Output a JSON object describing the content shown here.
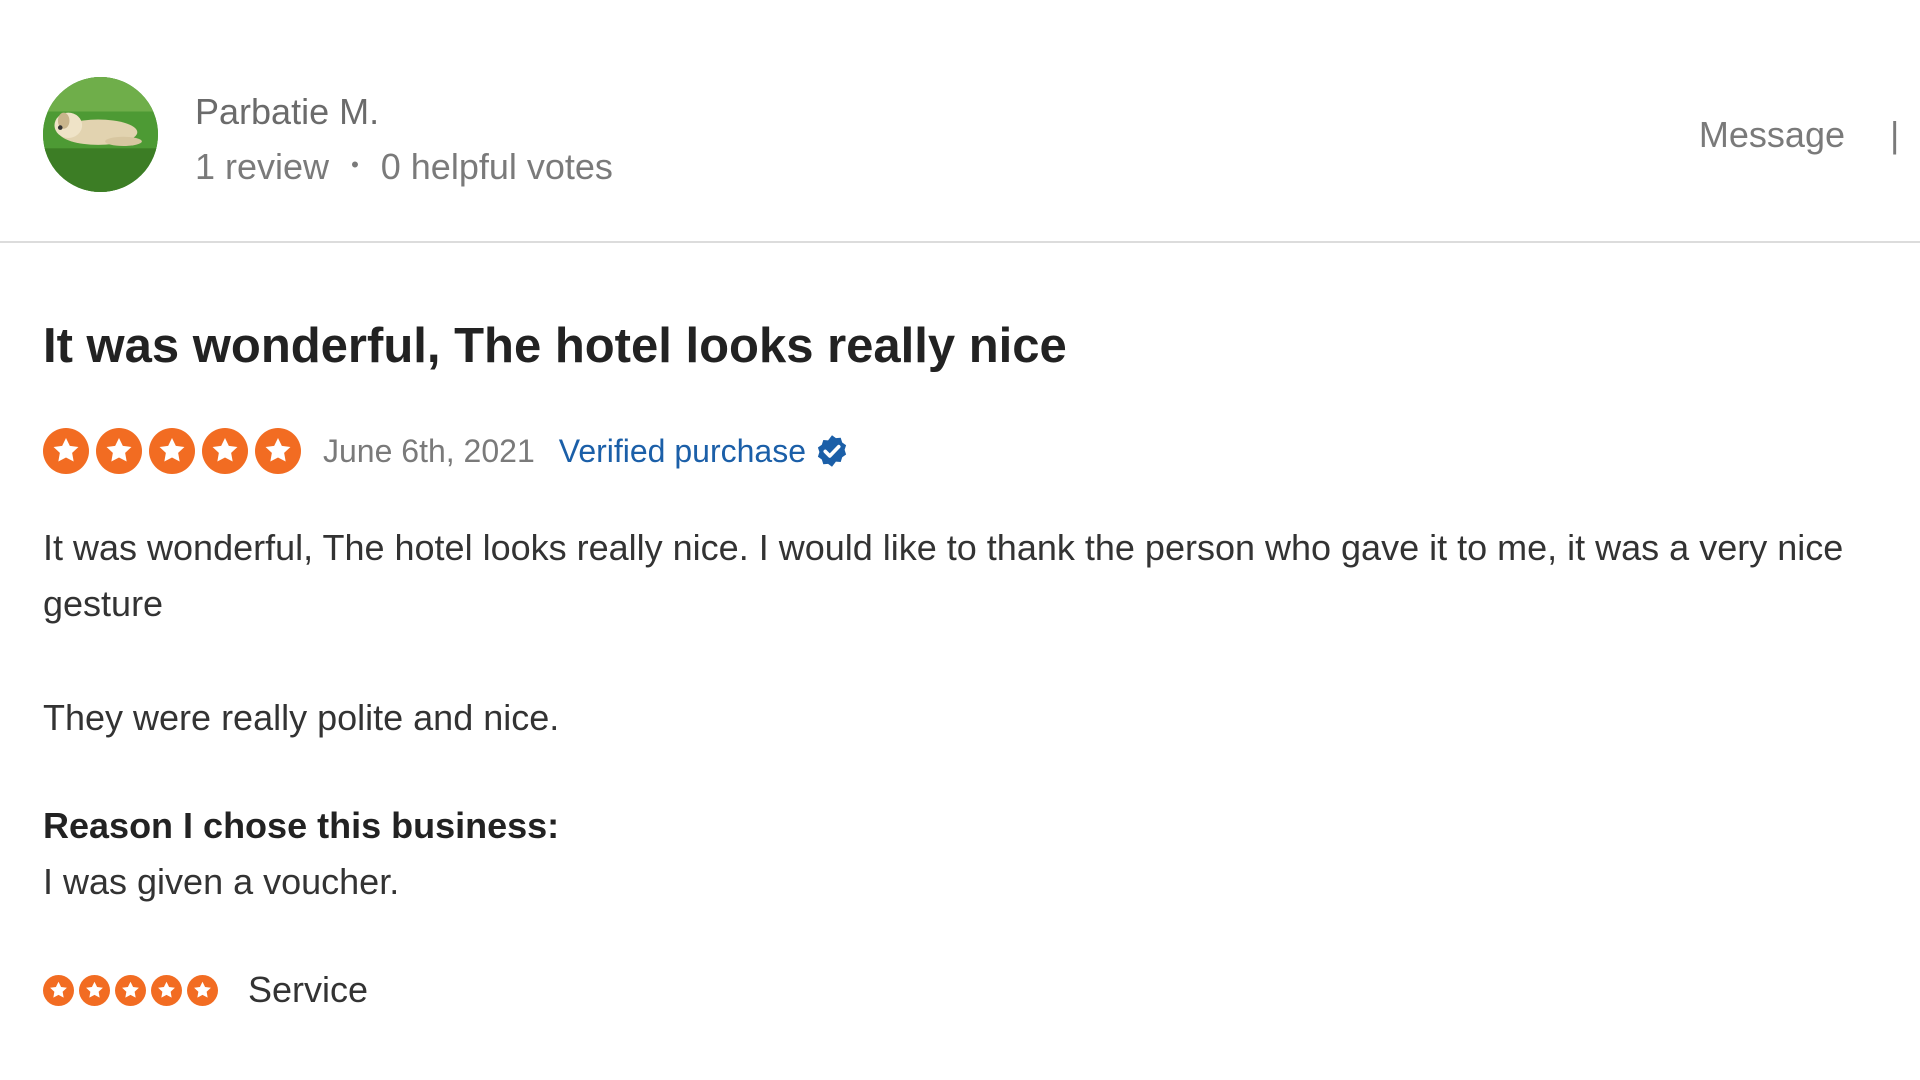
{
  "reviewer": {
    "name": "Parbatie M.",
    "reviews": "1 review",
    "separator": "•",
    "helpful_votes": "0 helpful votes",
    "message_label": "Message",
    "divider": "|"
  },
  "review": {
    "title": "It was wonderful, The hotel looks really nice",
    "rating": 5,
    "rating_max": 5,
    "date": "June 6th, 2021",
    "verified_label": "Verified purchase",
    "body_1": "It was wonderful, The hotel looks really nice. I would like to thank the person who gave it to me, it was a very nice gesture",
    "body_2": "They were really polite and nice.",
    "reason_label": "Reason I chose this business:",
    "reason_text": "I was given a voucher.",
    "sub_ratings": [
      {
        "label": "Service",
        "rating": 5
      }
    ]
  },
  "colors": {
    "star": "#f26c22",
    "verified": "#1b5fa8",
    "text": "#333333",
    "muted": "#7a7a7a"
  },
  "icons": {
    "star": "star-icon",
    "verified": "verified-check-icon",
    "avatar": "avatar-photo"
  }
}
